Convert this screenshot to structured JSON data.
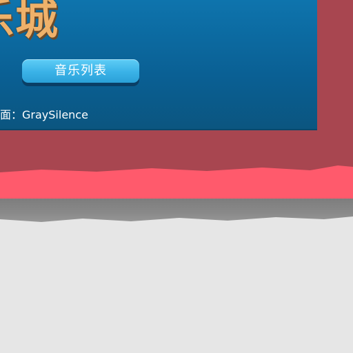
{
  "banner": {
    "title": "乐城",
    "music_list_button": "音乐列表",
    "credit_prefix": "界面：",
    "credit_author": "GraySilence"
  },
  "colors": {
    "panel_blue": "#0a5f93",
    "frame_red": "#a84650",
    "band_pink": "#ff5a6c",
    "title_gold": "#efb16a",
    "button_cyan": "#3ab2e7",
    "page_bg": "#e6e6e6"
  }
}
